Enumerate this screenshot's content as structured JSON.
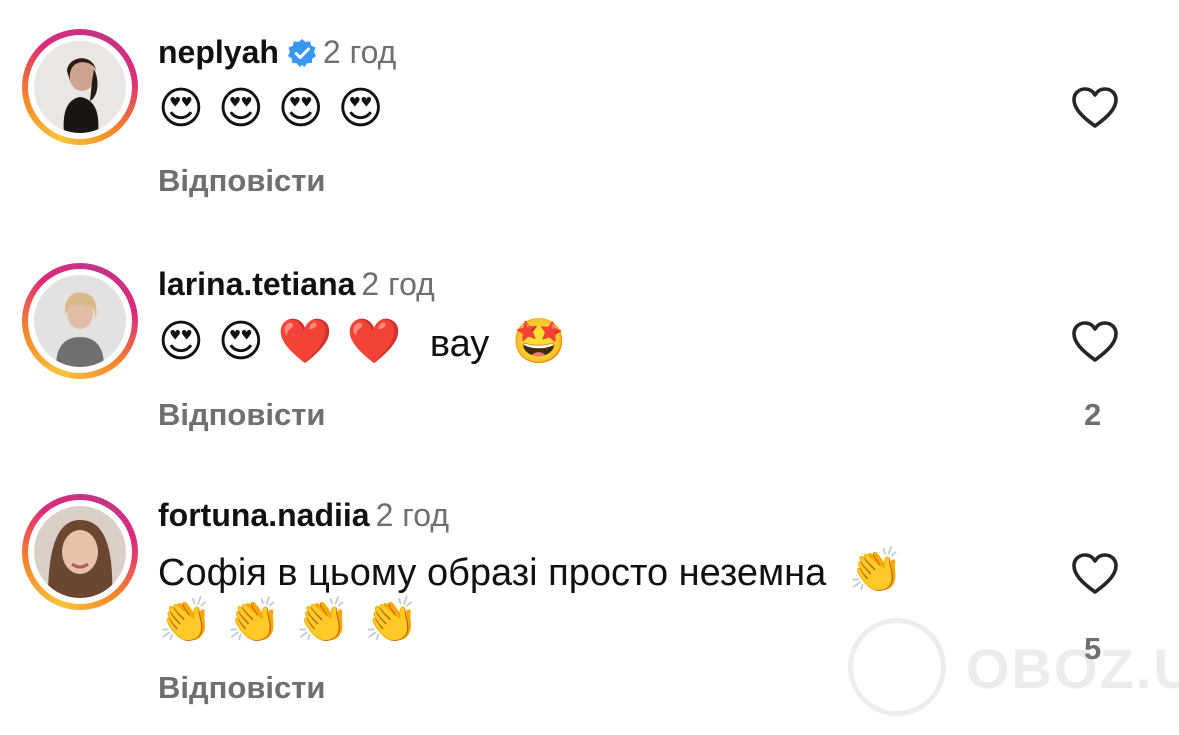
{
  "comments": [
    {
      "username": "neplyah",
      "verified": true,
      "time": "2 год",
      "text_emojis": "😍 😍 😍 😍",
      "text": "",
      "reply_label": "Відповісти",
      "likes": ""
    },
    {
      "username": "larina.tetiana",
      "verified": false,
      "time": "2 год",
      "text_emojis": "😍 😍 ❤️ ❤️",
      "text": "вау",
      "text_emoji_after": "🤩",
      "reply_label": "Відповісти",
      "likes": "2"
    },
    {
      "username": "fortuna.nadiia",
      "verified": false,
      "time": "2 год",
      "text": "Софія в цьому образі просто неземна",
      "text_emoji_after": "👏",
      "text_line2": "👏 👏 👏 👏",
      "reply_label": "Відповісти",
      "likes": "5"
    }
  ],
  "icons": {
    "heart": "heart-outline-icon",
    "verified": "verified-badge-icon"
  },
  "colors": {
    "verified_blue": "#3897f0",
    "secondary_text": "#6f6f6f"
  },
  "watermark": {
    "text": "OBOZ.UA"
  }
}
